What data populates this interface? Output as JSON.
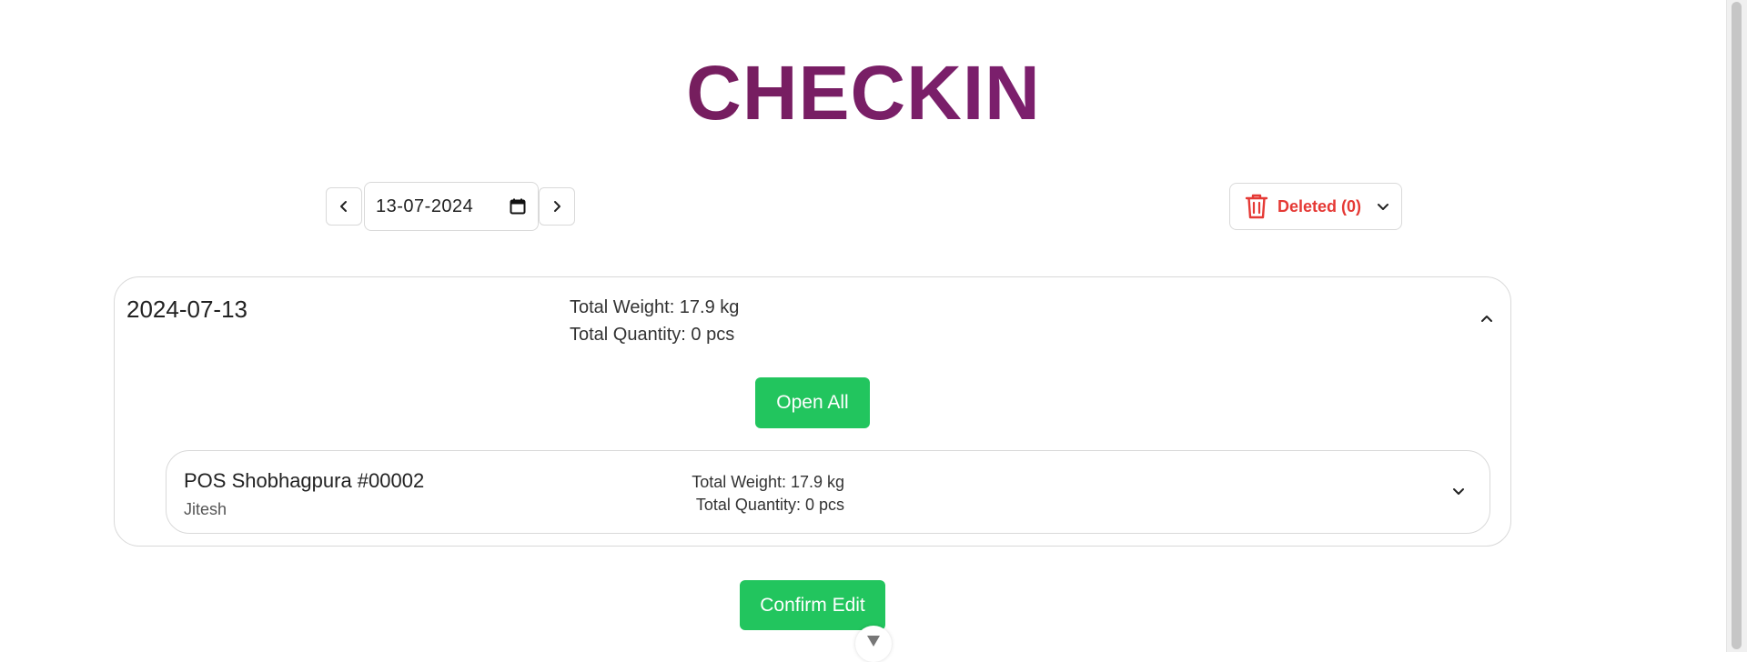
{
  "title": "CHECKIN",
  "date_picker": {
    "value": "13-07-2024"
  },
  "deleted": {
    "label": "Deleted (0)"
  },
  "group": {
    "date": "2024-07-13",
    "total_weight": "Total Weight: 17.9 kg",
    "total_quantity": "Total Quantity: 0 pcs",
    "open_all_label": "Open All",
    "pos": {
      "name": "POS Shobhagpura #00002",
      "user": "Jitesh",
      "total_weight": "Total Weight: 17.9 kg",
      "total_quantity": "Total Quantity: 0 pcs"
    }
  },
  "confirm_label": "Confirm Edit",
  "colors": {
    "accent_green": "#22c55e",
    "danger_red": "#e53935",
    "title_gradient_start": "#6b1b3f",
    "title_gradient_end": "#8a1d87"
  },
  "icons": [
    "chevron-left-icon",
    "chevron-right-icon",
    "calendar-icon",
    "trash-icon",
    "chevron-down-icon",
    "chevron-up-icon"
  ]
}
